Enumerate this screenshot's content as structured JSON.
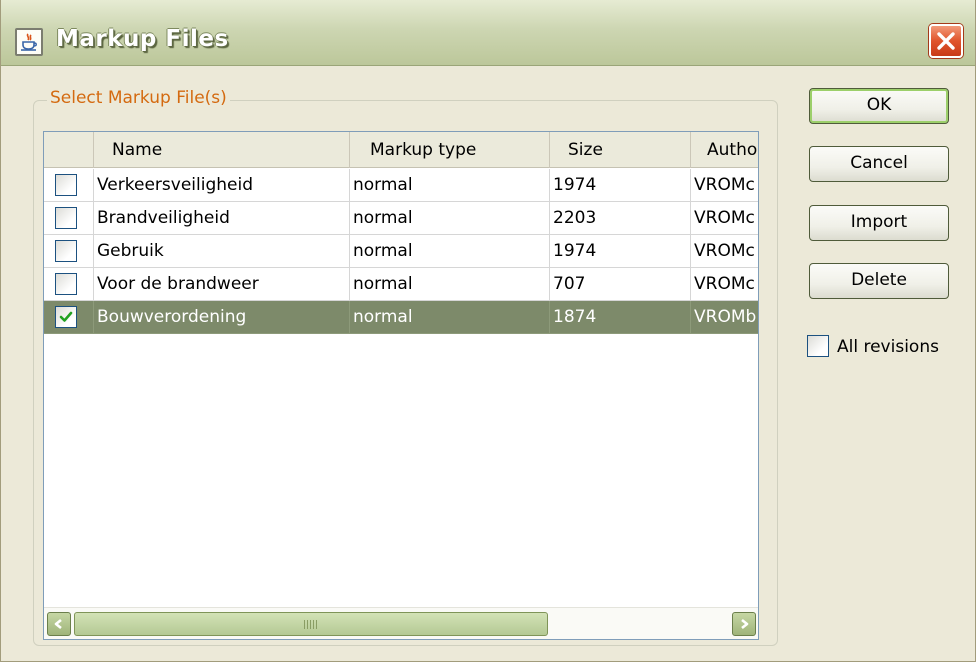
{
  "window": {
    "title": "Markup Files",
    "icon": "java-cup-icon",
    "accent": "#bcc79a",
    "close_color": "#e0542c"
  },
  "group": {
    "label": "Select Markup File(s)",
    "label_color": "#d46a10"
  },
  "table": {
    "columns": [
      "",
      "Name",
      "Markup type",
      "Size",
      "Autho"
    ],
    "rows": [
      {
        "checked": false,
        "name": "Verkeersveiligheid",
        "type": "normal",
        "size": "1974",
        "author": "VROMc"
      },
      {
        "checked": false,
        "name": "Brandveiligheid",
        "type": "normal",
        "size": "2203",
        "author": "VROMc"
      },
      {
        "checked": false,
        "name": "Gebruik",
        "type": "normal",
        "size": "1974",
        "author": "VROMc"
      },
      {
        "checked": false,
        "name": "Voor de brandweer",
        "type": "normal",
        "size": "707",
        "author": "VROMc"
      },
      {
        "checked": true,
        "name": "Bouwverordening",
        "type": "normal",
        "size": "1874",
        "author": "VROMb"
      }
    ],
    "selected_row_color": "#7d8a6a"
  },
  "buttons": {
    "ok": "OK",
    "cancel": "Cancel",
    "import": "Import",
    "delete": "Delete"
  },
  "all_revisions": {
    "label": "All revisions",
    "checked": false
  }
}
